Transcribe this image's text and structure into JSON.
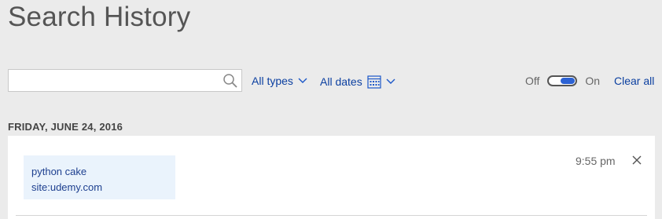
{
  "page": {
    "title": "Search History"
  },
  "search": {
    "value": "",
    "placeholder": ""
  },
  "filters": {
    "types_label": "All types",
    "dates_label": "All dates"
  },
  "toggle": {
    "off_label": "Off",
    "on_label": "On",
    "state": "on"
  },
  "actions": {
    "clear_all": "Clear all"
  },
  "history": [
    {
      "date": "FRIDAY, JUNE 24, 2016",
      "entries": [
        {
          "query_line1": "python cake",
          "query_line2": "site:udemy.com",
          "time": "9:55 pm"
        }
      ]
    }
  ],
  "colors": {
    "accent": "#0b3fa0",
    "toggle_on": "#2c62d4",
    "entry_bg": "#eaf3fc"
  }
}
